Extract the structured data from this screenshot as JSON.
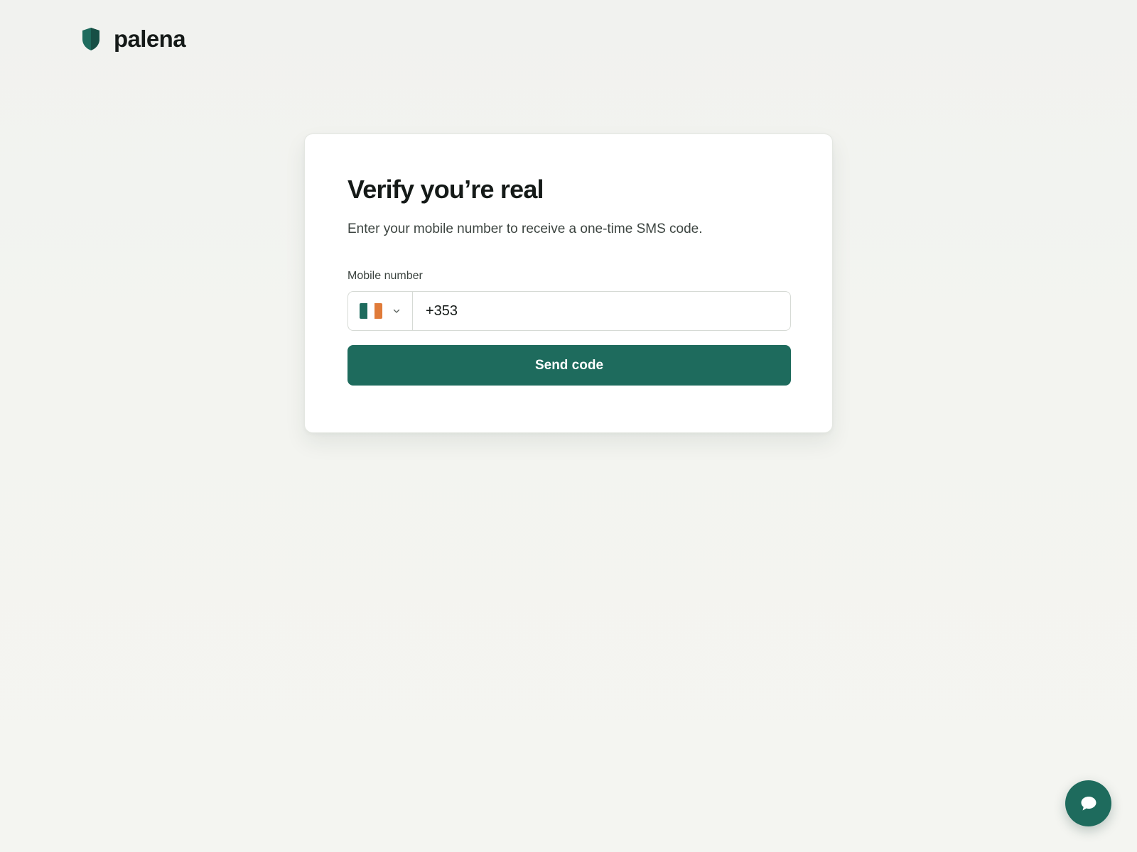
{
  "brand": {
    "name": "palena",
    "icon": "shield-icon"
  },
  "card": {
    "title": "Verify you’re real",
    "subtitle": "Enter your mobile number to receive a one-time SMS code.",
    "field_label": "Mobile number",
    "country": {
      "selected": "Ireland",
      "flag_colors": [
        "#1e6b5d",
        "#ffffff",
        "#e07b39"
      ],
      "icon": "chevron-down-icon"
    },
    "phone_value": "+353",
    "send_label": "Send code"
  },
  "chat": {
    "icon": "chat-bubble-icon"
  },
  "colors": {
    "accent": "#1e6b5d",
    "background": "#f3f4f0",
    "text": "#151a18"
  }
}
